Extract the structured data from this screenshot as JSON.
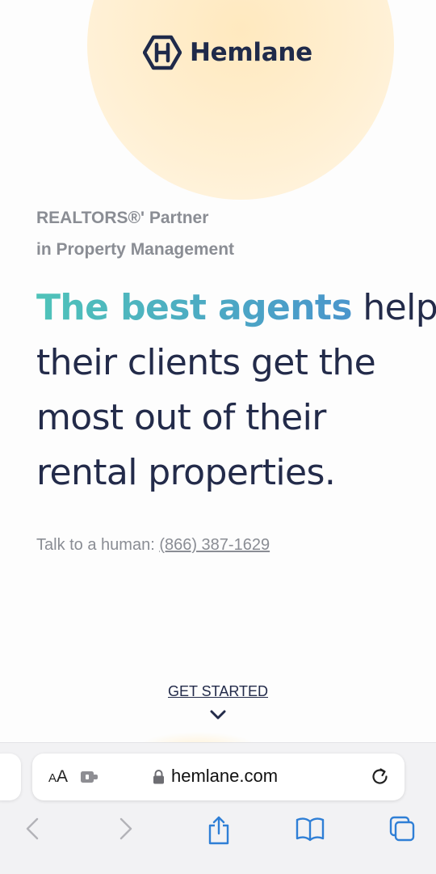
{
  "brand": {
    "name": "Hemlane",
    "logo_icon": "hexagon-h-logo"
  },
  "hero": {
    "eyebrow_line1": "REALTORS®' Partner",
    "eyebrow_line2": "in Property Management",
    "headline_highlight": "The best agents",
    "headline_rest1": " help",
    "headline_line2": "their clients get the",
    "headline_line3": "most out of their",
    "headline_line4": "rental properties."
  },
  "contact": {
    "label": "Talk to a human: ",
    "phone": "(866) 387-1629"
  },
  "cta": {
    "label": "GET STARTED",
    "icon": "chevron-down-icon"
  },
  "browser": {
    "aa_small": "A",
    "aa_big": "A",
    "url": "hemlane.com",
    "icons": [
      "aa-icon",
      "extension-icon",
      "lock-icon",
      "reload-icon",
      "back-icon",
      "forward-icon",
      "share-icon",
      "bookmarks-icon",
      "tabs-icon"
    ]
  },
  "colors": {
    "navy": "#232b4a",
    "gray": "#8a8d94",
    "gradient_start": "#4fc3b9",
    "gradient_end": "#4a95cc",
    "accent_blue": "#2f7fd6",
    "glow": "#ffe9bf"
  }
}
